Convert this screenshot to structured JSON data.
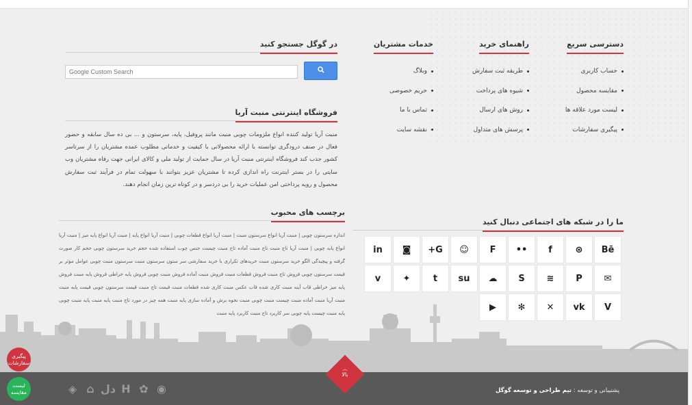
{
  "columns": {
    "quick_access": {
      "title": "دسترسی سریع",
      "items": [
        "حساب کاربری",
        "مقایسه محصول",
        "لیست مورد علاقه ها",
        "پیگیری سفارشات"
      ]
    },
    "buying_guide": {
      "title": "راهنمای خرید",
      "items": [
        "طریقه ثبت سفارش",
        "شیوه های پرداخت",
        "روش های ارسال",
        "پرسش های متداول"
      ]
    },
    "customer_services": {
      "title": "خدمات مشتریان",
      "items": [
        "وبلاگ",
        "حریم خصوصی",
        "تماس با ما",
        "نقشه سایت"
      ]
    }
  },
  "google_search": {
    "title": "در گوگل جستجو کنید",
    "placeholder": "Google Custom Search",
    "button_icon": "search-icon"
  },
  "about": {
    "title": "فروشگاه اینترنتی منبت آریا",
    "text": "منبت آریا تولید کننده انواع ملزومات چوبی منبت مانند پروفیل، پایه، سرستون و ... بی ده سال سابقه و حضور فعال در صنف درودگری توانسته با ارائه محصولاتی با کیفیت و خدماتی مطلوب عمده مشتریان را از سرتاسر کشور جذب کند فروشگاه اینترنتی منبت آریا در سال حمایت از تولید ملی و کالای ایرانی جهت رفاه مشتریان وب سایتی را در بستر اینترنت راه اندازی کرده تا مشتریان عزیز بتوانند با سهولت تمام در فرآیند ثبت سفارش محصول و رویه پرداختی امن عملیات خرید را بی دردسر و در کوتاه ترین زمان انجام دهند."
  },
  "tags": {
    "title": "برچسب های محبوب",
    "text": "اندازه سرستون چوبی | منبت آریا انواع سرستون منبت | منبت آریا انواع قطعات چوبی | منبت آریا انواع پایه | منبت آریا انواع پایه میز | منبت آریا انواع پایه چوبی | منبت آریا تاج منبت تاج منبت آماده تاج منبت چیست جنس چوب استفاده شده حجم خرید سرستون چوبی حجم کار صورت گرفته و پیچیدگی الگو خرید سرستون منبت خریدهای تکراری با خرید سفارشی سر ستون سرستون منبت سرستون منبت چوبی عوامل مؤثر بر قیمت سرستون چوبی فروش تاج منبت فروش قطعات منبت فروش منبت آماده فروش منبت چوبی فروش پایه خراطی فروش پایه منبت فروش پایه میز خراطی قاب آینه منبت کاری شده قاب عکس منبت کاری شده قطعات منبت قیمت تاج منبت قیمت سرستون چوبی قیمت پایه منبت منبت آریا منبت آماده منبت چیست منبت چوبی منبت نحوه برش و آماده سازی پایه منبت همه چیز در مورد تاج منبت پایه منبت پایه منبت چوبی پایه منبت چیست پایه چوبی سر کاربرد تاج منبت کاربرد پایه منبت"
  },
  "social": {
    "title": "ما را در شبکه های اجتماعی دنبال کنید",
    "icons": [
      {
        "name": "behance-icon",
        "glyph": "Bē"
      },
      {
        "name": "dribbble-icon",
        "glyph": "⊛"
      },
      {
        "name": "facebook-icon",
        "glyph": "f"
      },
      {
        "name": "flickr-icon",
        "glyph": "••"
      },
      {
        "name": "foursquare-icon",
        "glyph": "F"
      },
      {
        "name": "github-icon",
        "glyph": "☺"
      },
      {
        "name": "google-plus-icon",
        "glyph": "G+"
      },
      {
        "name": "instagram-icon",
        "glyph": "◙"
      },
      {
        "name": "linkedin-icon",
        "glyph": "in"
      },
      {
        "name": "mail-icon",
        "glyph": "✉"
      },
      {
        "name": "pinterest-icon",
        "glyph": "P"
      },
      {
        "name": "rss-icon",
        "glyph": "≋"
      },
      {
        "name": "skype-icon",
        "glyph": "S"
      },
      {
        "name": "soundcloud-icon",
        "glyph": "☁"
      },
      {
        "name": "stumbleupon-icon",
        "glyph": "su"
      },
      {
        "name": "tumblr-icon",
        "glyph": "t"
      },
      {
        "name": "twitter-icon",
        "glyph": "✦"
      },
      {
        "name": "vimeo-icon",
        "glyph": "v"
      },
      {
        "name": "vine-icon",
        "glyph": "V"
      },
      {
        "name": "vk-icon",
        "glyph": "vk"
      },
      {
        "name": "xing-icon",
        "glyph": "✕"
      },
      {
        "name": "yelp-icon",
        "glyph": "✻"
      },
      {
        "name": "youtube-icon",
        "glyph": "▶"
      }
    ]
  },
  "footer": {
    "support_label": "پشتیبانی و توسعه :",
    "support_team": "تیم طراحی و توسعه گوگل",
    "back_to_top": "بالا",
    "badges": [
      "enamad-icon",
      "samandehi-icon",
      "dl-icon",
      "h-icon",
      "gear-flower-icon",
      "camera-icon"
    ]
  },
  "floating": {
    "track_orders": "پیگیری سفارشات",
    "compare_list": "لیست مقایسه"
  },
  "colors": {
    "accent": "#d0343f",
    "google_button": "#4d8ee9",
    "footer_bg": "#595959",
    "compare_button": "#2bb35a"
  }
}
